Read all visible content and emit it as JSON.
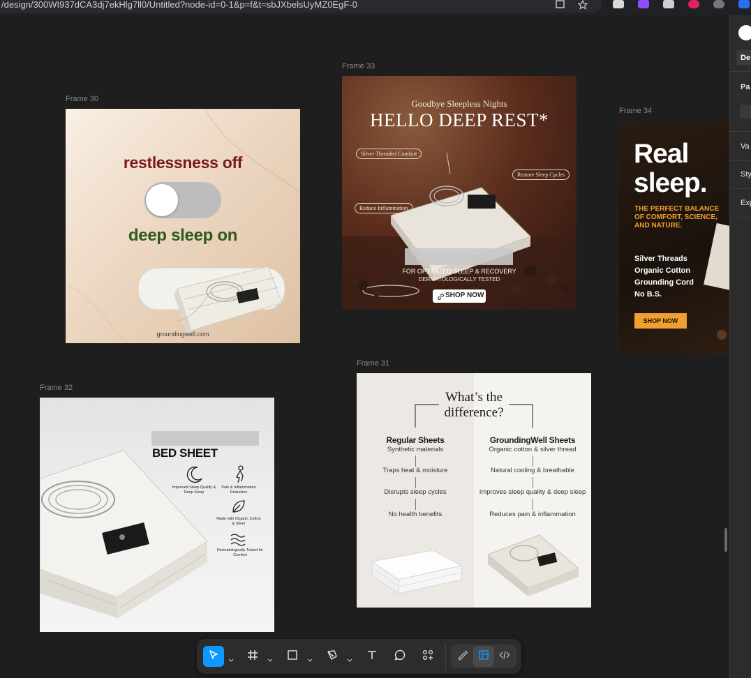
{
  "browser": {
    "url": "/design/300WI937dCA3dj7ekHlg7ll0/Untitled?node-id=0-1&p=f&t=sbJXbelsUyMZ0EgF-0"
  },
  "frames": {
    "f30": {
      "label": "Frame 30",
      "line1": "restlessness off",
      "line2": "deep sleep on",
      "site": "groundingwell.com"
    },
    "f33": {
      "label": "Frame 33",
      "kicker": "Goodbye Sleepless Nights",
      "headline": "HELLO DEEP REST*",
      "callout1": "Silver Threaded Comfort",
      "callout2": "Restore Sleep Cycles",
      "callout3": "Reduce Inflammation",
      "sub1": "FOR OPTIMIZED SLEEP & RECOVERY",
      "sub2": "DERMATOLOGICALLY TESTED",
      "cta": "SHOP NOW"
    },
    "f34": {
      "label": "Frame 34",
      "h1": "Real",
      "h2": "sleep.",
      "tag": "THE PERFECT BALANCE OF COMFORT, SCIENCE, AND NATURE.",
      "features": [
        "Silver Threads",
        "Organic Cotton",
        "Grounding Cord",
        "No B.S."
      ],
      "cta": "SHOP NOW"
    },
    "f32": {
      "label": "Frame 32",
      "title": "BED SHEET",
      "benefits": [
        "Improved Sleep Quality & Deep Sleep",
        "Pain & Inflammation Reduction",
        "Made with Organic Cotton & Silver",
        "Dermatologically Tested for Comfort"
      ]
    },
    "f31": {
      "label": "Frame 31",
      "title1": "What’s the",
      "title2": "difference?",
      "left_head": "Regular Sheets",
      "left_sub": "Synthetic materials",
      "right_head": "GroundingWell Sheets",
      "right_sub": "Organic cotton & silver thread",
      "left_rows": [
        "Traps heat & moisture",
        "Disrupts sleep cycles",
        "No health benefits"
      ],
      "right_rows": [
        "Natural cooling & breathable",
        "Improves sleep quality & deep sleep",
        "Reduces pain & inflammation"
      ]
    }
  },
  "right_panel": {
    "tab": "De",
    "items": [
      "Pa",
      "Va",
      "Sty",
      "Exp"
    ]
  },
  "toolbar": {
    "tools": [
      "move-tool",
      "frame-tool",
      "shape-tool",
      "pen-tool",
      "text-tool",
      "comment-tool",
      "assets-tool"
    ],
    "modes": [
      "draw-mode",
      "design-mode",
      "dev-mode"
    ],
    "accent": "#0d99ff"
  }
}
